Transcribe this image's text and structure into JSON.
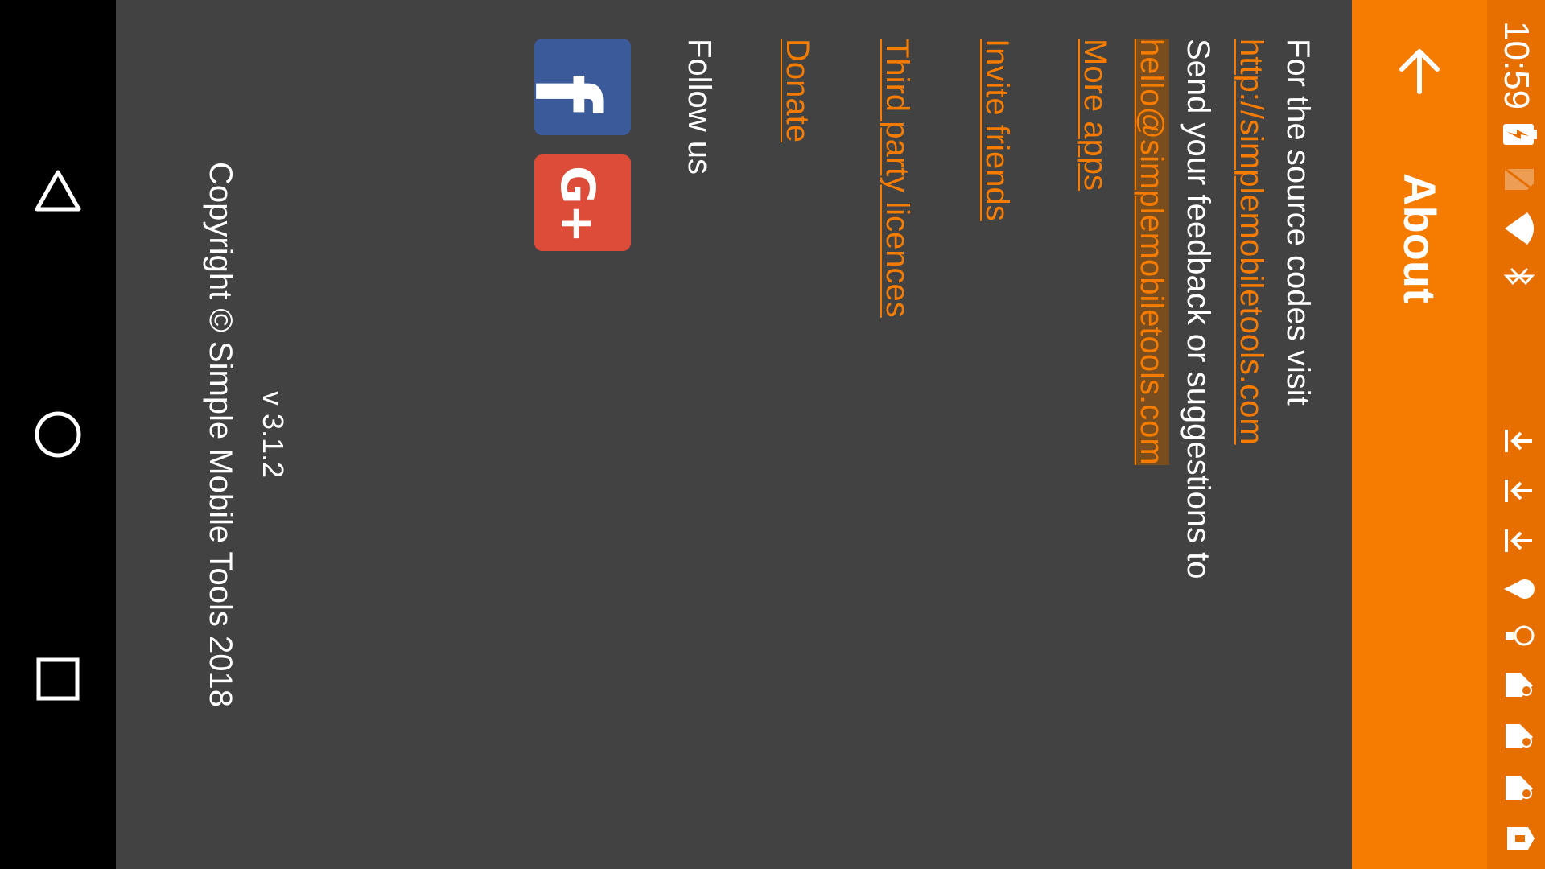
{
  "statusbar": {
    "time": "10:59",
    "icons": [
      "charging-battery-icon",
      "no-sim-icon",
      "wifi-icon",
      "bluetooth-icon",
      "download-icon",
      "download-icon",
      "download-icon",
      "location-icon",
      "bulb-icon",
      "notification-icon",
      "notification-icon",
      "notification-icon",
      "shield-icon"
    ]
  },
  "toolbar": {
    "title": "About"
  },
  "about": {
    "source_text": "For the source codes visit",
    "source_link": "http://simplemobiletools.com",
    "feedback_text": "Send your feedback or suggestions to",
    "email": "hello@simplemobiletools.com",
    "more_apps": "More apps",
    "invite_friends": "Invite friends",
    "third_party": "Third party licences",
    "donate": "Donate",
    "follow_us": "Follow us",
    "facebook_glyph": "f",
    "gplus_glyph": "G+",
    "version": "v 3.1.2",
    "copyright": "Copyright © Simple Mobile Tools 2018"
  },
  "colors": {
    "accent": "#f57c00",
    "statusbar": "#e66f00",
    "background": "#424242",
    "facebook": "#3b5a9a",
    "googleplus": "#dd4b39"
  }
}
